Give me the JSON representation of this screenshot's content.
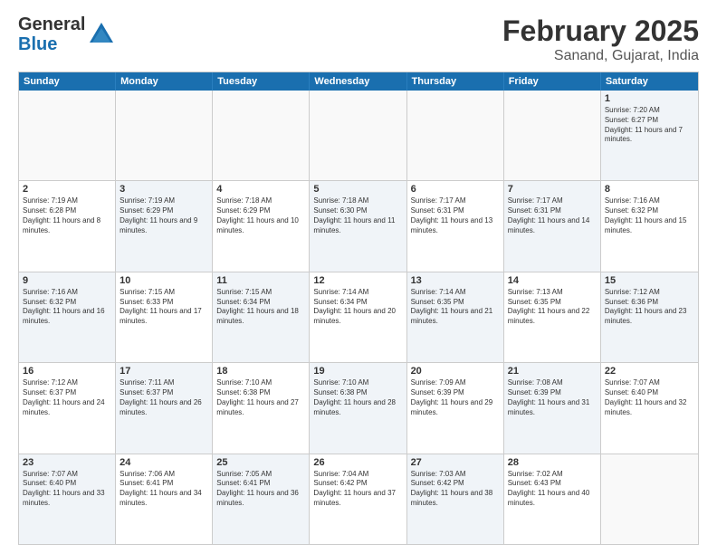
{
  "logo": {
    "general": "General",
    "blue": "Blue"
  },
  "title": "February 2025",
  "subtitle": "Sanand, Gujarat, India",
  "header_days": [
    "Sunday",
    "Monday",
    "Tuesday",
    "Wednesday",
    "Thursday",
    "Friday",
    "Saturday"
  ],
  "weeks": [
    [
      {
        "day": "",
        "text": "",
        "shaded": false,
        "empty": true
      },
      {
        "day": "",
        "text": "",
        "shaded": false,
        "empty": true
      },
      {
        "day": "",
        "text": "",
        "shaded": false,
        "empty": true
      },
      {
        "day": "",
        "text": "",
        "shaded": false,
        "empty": true
      },
      {
        "day": "",
        "text": "",
        "shaded": false,
        "empty": true
      },
      {
        "day": "",
        "text": "",
        "shaded": false,
        "empty": true
      },
      {
        "day": "1",
        "text": "Sunrise: 7:20 AM\nSunset: 6:27 PM\nDaylight: 11 hours and 7 minutes.",
        "shaded": true,
        "empty": false
      }
    ],
    [
      {
        "day": "2",
        "text": "Sunrise: 7:19 AM\nSunset: 6:28 PM\nDaylight: 11 hours and 8 minutes.",
        "shaded": false,
        "empty": false
      },
      {
        "day": "3",
        "text": "Sunrise: 7:19 AM\nSunset: 6:29 PM\nDaylight: 11 hours and 9 minutes.",
        "shaded": true,
        "empty": false
      },
      {
        "day": "4",
        "text": "Sunrise: 7:18 AM\nSunset: 6:29 PM\nDaylight: 11 hours and 10 minutes.",
        "shaded": false,
        "empty": false
      },
      {
        "day": "5",
        "text": "Sunrise: 7:18 AM\nSunset: 6:30 PM\nDaylight: 11 hours and 11 minutes.",
        "shaded": true,
        "empty": false
      },
      {
        "day": "6",
        "text": "Sunrise: 7:17 AM\nSunset: 6:31 PM\nDaylight: 11 hours and 13 minutes.",
        "shaded": false,
        "empty": false
      },
      {
        "day": "7",
        "text": "Sunrise: 7:17 AM\nSunset: 6:31 PM\nDaylight: 11 hours and 14 minutes.",
        "shaded": true,
        "empty": false
      },
      {
        "day": "8",
        "text": "Sunrise: 7:16 AM\nSunset: 6:32 PM\nDaylight: 11 hours and 15 minutes.",
        "shaded": false,
        "empty": false
      }
    ],
    [
      {
        "day": "9",
        "text": "Sunrise: 7:16 AM\nSunset: 6:32 PM\nDaylight: 11 hours and 16 minutes.",
        "shaded": true,
        "empty": false
      },
      {
        "day": "10",
        "text": "Sunrise: 7:15 AM\nSunset: 6:33 PM\nDaylight: 11 hours and 17 minutes.",
        "shaded": false,
        "empty": false
      },
      {
        "day": "11",
        "text": "Sunrise: 7:15 AM\nSunset: 6:34 PM\nDaylight: 11 hours and 18 minutes.",
        "shaded": true,
        "empty": false
      },
      {
        "day": "12",
        "text": "Sunrise: 7:14 AM\nSunset: 6:34 PM\nDaylight: 11 hours and 20 minutes.",
        "shaded": false,
        "empty": false
      },
      {
        "day": "13",
        "text": "Sunrise: 7:14 AM\nSunset: 6:35 PM\nDaylight: 11 hours and 21 minutes.",
        "shaded": true,
        "empty": false
      },
      {
        "day": "14",
        "text": "Sunrise: 7:13 AM\nSunset: 6:35 PM\nDaylight: 11 hours and 22 minutes.",
        "shaded": false,
        "empty": false
      },
      {
        "day": "15",
        "text": "Sunrise: 7:12 AM\nSunset: 6:36 PM\nDaylight: 11 hours and 23 minutes.",
        "shaded": true,
        "empty": false
      }
    ],
    [
      {
        "day": "16",
        "text": "Sunrise: 7:12 AM\nSunset: 6:37 PM\nDaylight: 11 hours and 24 minutes.",
        "shaded": false,
        "empty": false
      },
      {
        "day": "17",
        "text": "Sunrise: 7:11 AM\nSunset: 6:37 PM\nDaylight: 11 hours and 26 minutes.",
        "shaded": true,
        "empty": false
      },
      {
        "day": "18",
        "text": "Sunrise: 7:10 AM\nSunset: 6:38 PM\nDaylight: 11 hours and 27 minutes.",
        "shaded": false,
        "empty": false
      },
      {
        "day": "19",
        "text": "Sunrise: 7:10 AM\nSunset: 6:38 PM\nDaylight: 11 hours and 28 minutes.",
        "shaded": true,
        "empty": false
      },
      {
        "day": "20",
        "text": "Sunrise: 7:09 AM\nSunset: 6:39 PM\nDaylight: 11 hours and 29 minutes.",
        "shaded": false,
        "empty": false
      },
      {
        "day": "21",
        "text": "Sunrise: 7:08 AM\nSunset: 6:39 PM\nDaylight: 11 hours and 31 minutes.",
        "shaded": true,
        "empty": false
      },
      {
        "day": "22",
        "text": "Sunrise: 7:07 AM\nSunset: 6:40 PM\nDaylight: 11 hours and 32 minutes.",
        "shaded": false,
        "empty": false
      }
    ],
    [
      {
        "day": "23",
        "text": "Sunrise: 7:07 AM\nSunset: 6:40 PM\nDaylight: 11 hours and 33 minutes.",
        "shaded": true,
        "empty": false
      },
      {
        "day": "24",
        "text": "Sunrise: 7:06 AM\nSunset: 6:41 PM\nDaylight: 11 hours and 34 minutes.",
        "shaded": false,
        "empty": false
      },
      {
        "day": "25",
        "text": "Sunrise: 7:05 AM\nSunset: 6:41 PM\nDaylight: 11 hours and 36 minutes.",
        "shaded": true,
        "empty": false
      },
      {
        "day": "26",
        "text": "Sunrise: 7:04 AM\nSunset: 6:42 PM\nDaylight: 11 hours and 37 minutes.",
        "shaded": false,
        "empty": false
      },
      {
        "day": "27",
        "text": "Sunrise: 7:03 AM\nSunset: 6:42 PM\nDaylight: 11 hours and 38 minutes.",
        "shaded": true,
        "empty": false
      },
      {
        "day": "28",
        "text": "Sunrise: 7:02 AM\nSunset: 6:43 PM\nDaylight: 11 hours and 40 minutes.",
        "shaded": false,
        "empty": false
      },
      {
        "day": "",
        "text": "",
        "shaded": true,
        "empty": true
      }
    ]
  ]
}
